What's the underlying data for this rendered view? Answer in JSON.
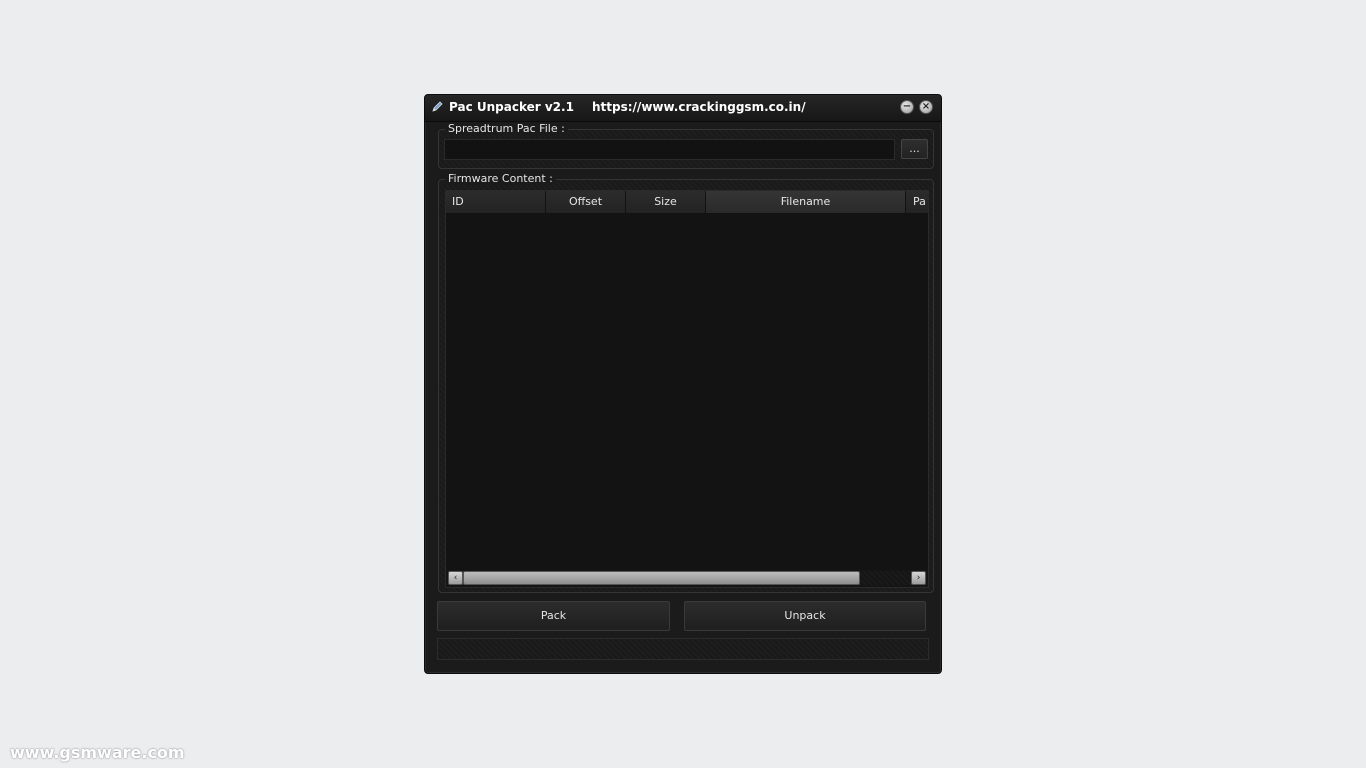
{
  "window": {
    "title": "Pac Unpacker v2.1",
    "url": "https://www.crackinggsm.co.in/",
    "minimize_glyph": "−",
    "close_glyph": "×",
    "icon": "app-pen-icon"
  },
  "file_group": {
    "label": "Spreadtrum Pac File :",
    "value": "",
    "placeholder": "",
    "browse_label": "..."
  },
  "firmware_group": {
    "label": "Firmware Content :",
    "columns": [
      "ID",
      "Offset",
      "Size",
      "Filename",
      "Pa"
    ],
    "rows": [],
    "scrollbar": {
      "left_arrow": "‹",
      "right_arrow": "›",
      "thumb_fraction": 0.886,
      "position_fraction": 0.0
    }
  },
  "actions": {
    "pack_label": "Pack",
    "unpack_label": "Unpack"
  },
  "status": {
    "text": ""
  },
  "watermark": "www.gsmware.com",
  "colors": {
    "window_bg": "#1b1b1b",
    "page_bg": "#ecedef",
    "text": "#e6e6e6"
  }
}
